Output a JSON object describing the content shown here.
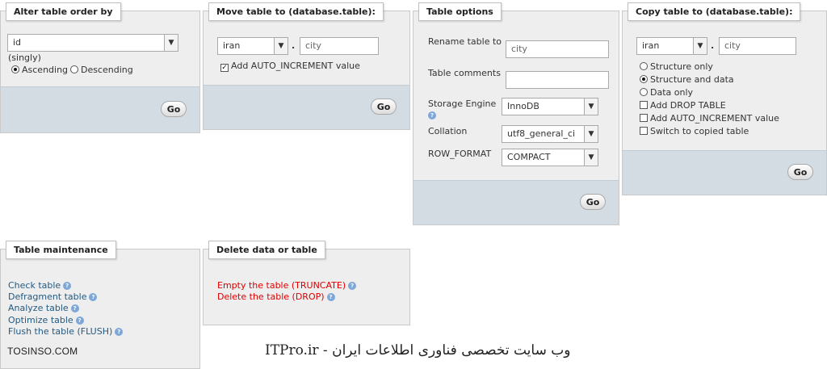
{
  "alter_order": {
    "title": "Alter table order by",
    "column_value": "id",
    "singly": "(singly)",
    "ascending": "Ascending",
    "descending": "Descending",
    "go": "Go"
  },
  "move_table": {
    "title": "Move table to (database.table):",
    "db_value": "iran",
    "dot": ".",
    "table_value": "city",
    "auto_increment": "Add AUTO_INCREMENT value",
    "go": "Go"
  },
  "table_options": {
    "title": "Table options",
    "rename_label": "Rename table to",
    "rename_value": "city",
    "comments_label": "Table comments",
    "comments_value": "",
    "engine_label": "Storage Engine",
    "engine_value": "InnoDB",
    "collation_label": "Collation",
    "collation_value": "utf8_general_ci",
    "rowformat_label": "ROW_FORMAT",
    "rowformat_value": "COMPACT",
    "go": "Go"
  },
  "copy_table": {
    "title": "Copy table to (database.table):",
    "db_value": "iran",
    "dot": ".",
    "table_value": "city",
    "structure_only": "Structure only",
    "structure_and_data": "Structure and data",
    "data_only": "Data only",
    "add_drop": "Add DROP TABLE",
    "add_auto_inc": "Add AUTO_INCREMENT value",
    "switch_copied": "Switch to copied table",
    "go": "Go"
  },
  "maintenance": {
    "title": "Table maintenance",
    "items": [
      "Check table",
      "Defragment table",
      "Analyze table",
      "Optimize table",
      "Flush the table (FLUSH)"
    ]
  },
  "delete_data": {
    "title": "Delete data or table",
    "items": [
      "Empty the table (TRUNCATE)",
      "Delete the table (DROP)"
    ]
  },
  "watermark": {
    "left": "TOSINSO.COM",
    "center": "ITPro.ir - وب سایت تخصصی فناوری اطلاعات ایران"
  },
  "colors": {
    "panel_bg": "#eeeeee",
    "footer_bg": "#d3dce3",
    "link": "#235a81",
    "danger_link": "#e00000"
  }
}
